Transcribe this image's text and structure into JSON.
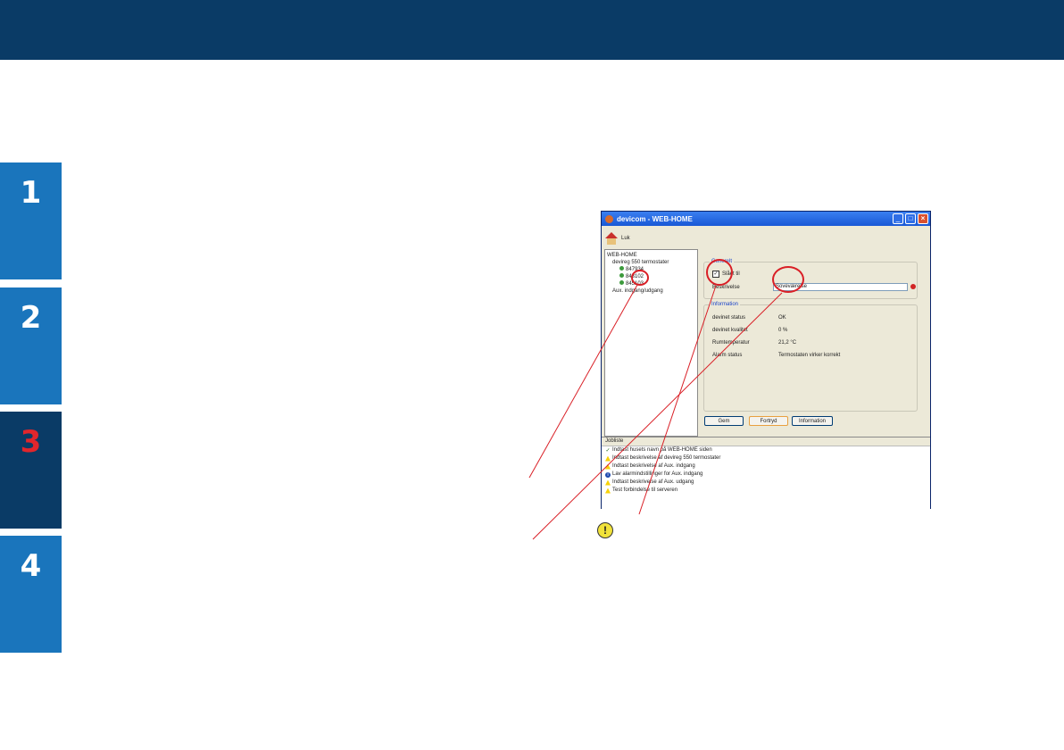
{
  "side_tabs": [
    {
      "label": "1",
      "active": false
    },
    {
      "label": "2",
      "active": false
    },
    {
      "label": "3",
      "active": true
    },
    {
      "label": "4",
      "active": false
    }
  ],
  "window": {
    "title": "devicom - WEB-HOME",
    "toolbar_label": "Luk",
    "tree": {
      "root": "WEB-HOME",
      "group1": "devireg 550 termostater",
      "items": [
        "847934",
        "843102",
        "845103"
      ],
      "group2": "Aux. indgang/udgang"
    },
    "general": {
      "legend": "Generelt",
      "checkbox_label": "Slået til",
      "checkbox_checked": true,
      "desc_label": "Beskrivelse",
      "desc_value": "Soveværelse"
    },
    "information": {
      "legend": "Information",
      "rows": [
        {
          "label": "devinet status",
          "value": "OK"
        },
        {
          "label": "devinet kvalitet",
          "value": "0 %"
        },
        {
          "label": "Rumtemperatur",
          "value": "21,2 °C"
        },
        {
          "label": "Alarm status",
          "value": "Termostaten virker korrekt"
        }
      ]
    },
    "buttons": {
      "save": "Gem",
      "undo": "Fortryd",
      "info": "Information"
    },
    "joblist": {
      "header": "Jobliste",
      "items": [
        {
          "icon": "check",
          "text": "Indtast husets navn på WEB-HOME siden"
        },
        {
          "icon": "warning",
          "text": "Indtast beskrivelse af devireg 550 termostater"
        },
        {
          "icon": "warning",
          "text": "Indtast beskrivelse af Aux. indgang"
        },
        {
          "icon": "info",
          "text": "Lav alarmindstillinger for Aux. indgang"
        },
        {
          "icon": "warning",
          "text": "Indtast beskrivelse af Aux. udgang"
        },
        {
          "icon": "warning",
          "text": "Test forbindelse til serveren"
        }
      ]
    }
  },
  "note_icon": "!"
}
